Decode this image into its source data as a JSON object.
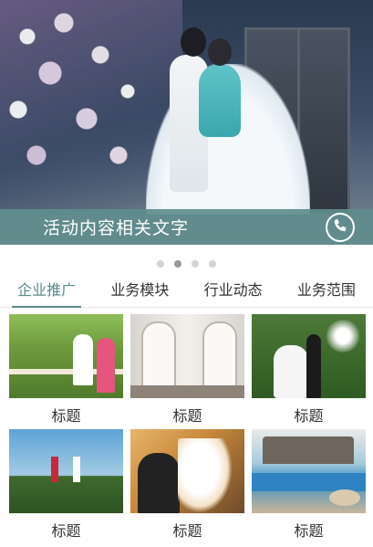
{
  "banner": {
    "caption": "活动内容相关文字",
    "phone_icon": "phone-icon"
  },
  "carousel": {
    "total": 4,
    "active_index": 1
  },
  "tabs": [
    {
      "label": "企业推广",
      "active": true
    },
    {
      "label": "业务模块",
      "active": false
    },
    {
      "label": "行业动态",
      "active": false
    },
    {
      "label": "业务范围",
      "active": false
    }
  ],
  "grid": {
    "items": [
      {
        "label": "标题"
      },
      {
        "label": "标题"
      },
      {
        "label": "标题"
      },
      {
        "label": "标题"
      },
      {
        "label": "标题"
      },
      {
        "label": "标题"
      }
    ]
  },
  "colors": {
    "accent": "#5a8a8a",
    "caption_bg": "#5f8c8c"
  }
}
